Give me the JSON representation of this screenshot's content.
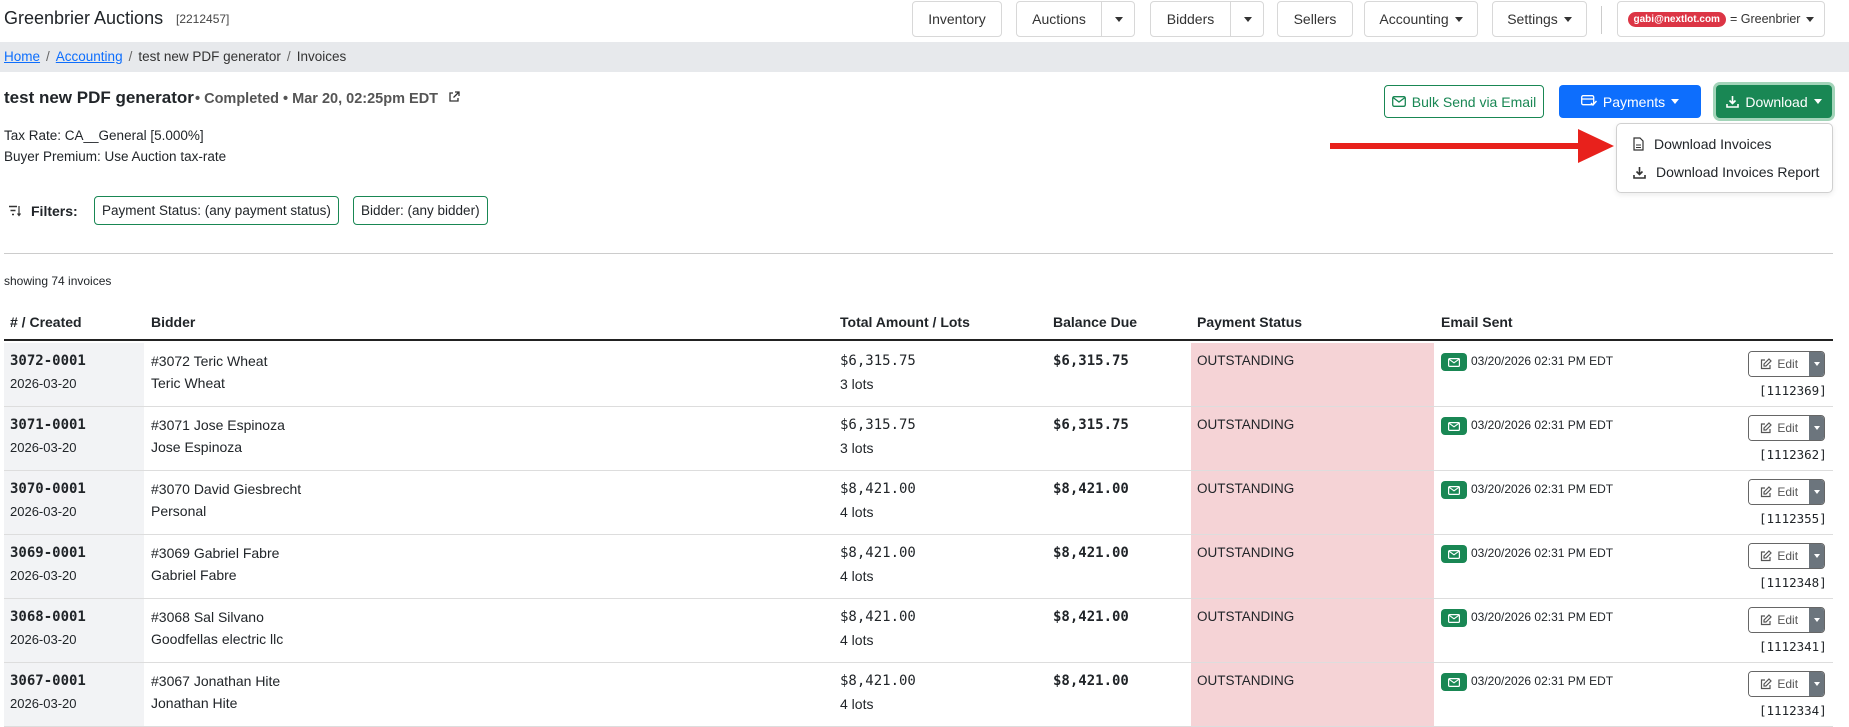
{
  "app": {
    "title": "Greenbrier Auctions",
    "id": "[2212457]"
  },
  "nav": {
    "inventory": "Inventory",
    "auctions": "Auctions",
    "bidders": "Bidders",
    "sellers": "Sellers",
    "accounting": "Accounting",
    "settings": "Settings",
    "user_email": "gabi@nextlot.com",
    "user_org": "= Greenbrier"
  },
  "breadcrumb": {
    "home": "Home",
    "accounting": "Accounting",
    "report": "test new PDF generator",
    "current": "Invoices",
    "separator": "/"
  },
  "header": {
    "title": "test new PDF generator",
    "status": "• Completed • Mar 20, 02:25pm EDT",
    "tax_rate": "Tax Rate: CA__General [5.000%]",
    "buyer_premium": "Buyer Premium: Use Auction tax-rate"
  },
  "actions": {
    "bulk_send": "Bulk Send via Email",
    "payments": "Payments",
    "download": "Download"
  },
  "download_menu": {
    "item1": "Download Invoices",
    "item2": "Download Invoices Report"
  },
  "filters": {
    "label": "Filters:",
    "payment_status": "Payment Status: (any payment status)",
    "bidder": "Bidder: (any bidder)"
  },
  "showing": "showing 74 invoices",
  "table": {
    "headers": [
      "# / Created",
      "Bidder",
      "Total Amount / Lots",
      "Balance Due",
      "Payment Status",
      "Email Sent"
    ],
    "edit_label": "Edit",
    "rows": [
      {
        "num": "3072-0001",
        "date": "2026-03-20",
        "bidder": "#3072 Teric Wheat",
        "sub": "Teric Wheat",
        "total": "$6,315.75",
        "lots": "3 lots",
        "balance": "$6,315.75",
        "status": "OUTSTANDING",
        "email": "03/20/2026 02:31 PM EDT",
        "id": "[1112369]"
      },
      {
        "num": "3071-0001",
        "date": "2026-03-20",
        "bidder": "#3071 Jose Espinoza",
        "sub": "Jose Espinoza",
        "total": "$6,315.75",
        "lots": "3 lots",
        "balance": "$6,315.75",
        "status": "OUTSTANDING",
        "email": "03/20/2026 02:31 PM EDT",
        "id": "[1112362]"
      },
      {
        "num": "3070-0001",
        "date": "2026-03-20",
        "bidder": "#3070 David Giesbrecht",
        "sub": "Personal",
        "total": "$8,421.00",
        "lots": "4 lots",
        "balance": "$8,421.00",
        "status": "OUTSTANDING",
        "email": "03/20/2026 02:31 PM EDT",
        "id": "[1112355]"
      },
      {
        "num": "3069-0001",
        "date": "2026-03-20",
        "bidder": "#3069 Gabriel Fabre",
        "sub": "Gabriel Fabre",
        "total": "$8,421.00",
        "lots": "4 lots",
        "balance": "$8,421.00",
        "status": "OUTSTANDING",
        "email": "03/20/2026 02:31 PM EDT",
        "id": "[1112348]"
      },
      {
        "num": "3068-0001",
        "date": "2026-03-20",
        "bidder": "#3068 Sal Silvano",
        "sub": "Goodfellas electric llc",
        "total": "$8,421.00",
        "lots": "4 lots",
        "balance": "$8,421.00",
        "status": "OUTSTANDING",
        "email": "03/20/2026 02:31 PM EDT",
        "id": "[1112341]"
      },
      {
        "num": "3067-0001",
        "date": "2026-03-20",
        "bidder": "#3067 Jonathan Hite",
        "sub": "Jonathan Hite",
        "total": "$8,421.00",
        "lots": "4 lots",
        "balance": "$8,421.00",
        "status": "OUTSTANDING",
        "email": "03/20/2026 02:31 PM EDT",
        "id": "[1112334]"
      }
    ]
  },
  "colors": {
    "accent_blue": "#0d6efd",
    "green": "#198754",
    "outstanding_bg": "#f5d3d6",
    "arrow": "#e8211c"
  }
}
